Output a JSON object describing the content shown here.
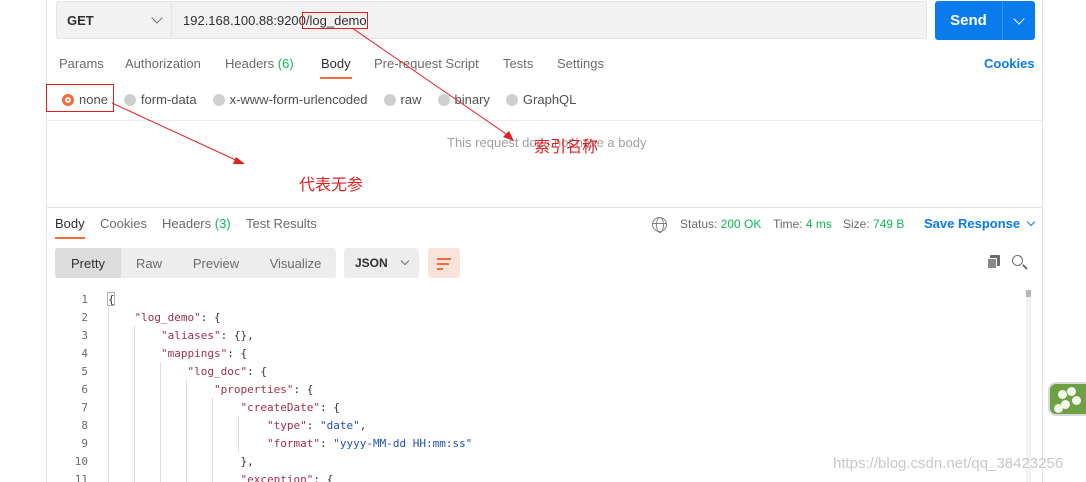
{
  "request": {
    "method": "GET",
    "url": "192.168.100.88:9200/log_demo",
    "send_label": "Send"
  },
  "request_tabs": [
    {
      "label": "Params",
      "count": ""
    },
    {
      "label": "Authorization",
      "count": ""
    },
    {
      "label": "Headers",
      "count": "(6)"
    },
    {
      "label": "Body",
      "count": ""
    },
    {
      "label": "Pre-request Script",
      "count": ""
    },
    {
      "label": "Tests",
      "count": ""
    },
    {
      "label": "Settings",
      "count": ""
    }
  ],
  "active_request_tab": "Body",
  "cookies_label": "Cookies",
  "body_options": [
    "none",
    "form-data",
    "x-www-form-urlencoded",
    "raw",
    "binary",
    "GraphQL"
  ],
  "selected_body_option": "none",
  "no_body_message": "This request does not have a body",
  "response_tabs": [
    {
      "label": "Body",
      "count": ""
    },
    {
      "label": "Cookies",
      "count": ""
    },
    {
      "label": "Headers",
      "count": "(3)"
    },
    {
      "label": "Test Results",
      "count": ""
    }
  ],
  "status": {
    "status_label": "Status:",
    "status_value": "200 OK",
    "time_label": "Time:",
    "time_value": "4 ms",
    "size_label": "Size:",
    "size_value": "749 B"
  },
  "save_response_label": "Save Response",
  "view_modes": [
    "Pretty",
    "Raw",
    "Preview",
    "Visualize"
  ],
  "active_view_mode": "Pretty",
  "format": "JSON",
  "code_lines": [
    {
      "n": "1",
      "indent": 0,
      "parts": [
        [
          "p",
          "{"
        ]
      ]
    },
    {
      "n": "2",
      "indent": 1,
      "parts": [
        [
          "k",
          "\"log_demo\""
        ],
        [
          "p",
          ": {"
        ]
      ]
    },
    {
      "n": "3",
      "indent": 2,
      "parts": [
        [
          "k",
          "\"aliases\""
        ],
        [
          "p",
          ": {},"
        ]
      ]
    },
    {
      "n": "4",
      "indent": 2,
      "parts": [
        [
          "k",
          "\"mappings\""
        ],
        [
          "p",
          ": {"
        ]
      ]
    },
    {
      "n": "5",
      "indent": 3,
      "parts": [
        [
          "k",
          "\"log_doc\""
        ],
        [
          "p",
          ": {"
        ]
      ]
    },
    {
      "n": "6",
      "indent": 4,
      "parts": [
        [
          "k",
          "\"properties\""
        ],
        [
          "p",
          ": {"
        ]
      ]
    },
    {
      "n": "7",
      "indent": 5,
      "parts": [
        [
          "k",
          "\"createDate\""
        ],
        [
          "p",
          ": {"
        ]
      ]
    },
    {
      "n": "8",
      "indent": 6,
      "parts": [
        [
          "k",
          "\"type\""
        ],
        [
          "p",
          ": "
        ],
        [
          "s",
          "\"date\""
        ],
        [
          "p",
          ","
        ]
      ]
    },
    {
      "n": "9",
      "indent": 6,
      "parts": [
        [
          "k",
          "\"format\""
        ],
        [
          "p",
          ": "
        ],
        [
          "s",
          "\"yyyy-MM-dd HH:mm:ss\""
        ]
      ]
    },
    {
      "n": "10",
      "indent": 5,
      "parts": [
        [
          "p",
          "},"
        ]
      ]
    },
    {
      "n": "11",
      "indent": 5,
      "parts": [
        [
          "k",
          "\"exception\""
        ],
        [
          "p",
          ": {"
        ]
      ]
    }
  ],
  "annotations": {
    "index_name": "索引名称",
    "no_params": "代表无参",
    "color": "#e02020"
  },
  "watermark": "https://blog.csdn.net/qq_38423256",
  "colors": {
    "accent_orange": "#f26b3a",
    "send_blue": "#097bed",
    "success_green": "#0cbb52"
  }
}
